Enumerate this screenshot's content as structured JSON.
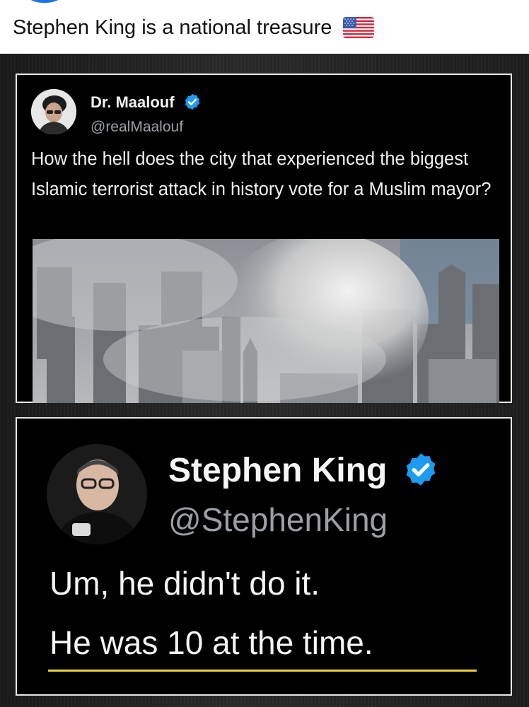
{
  "post": {
    "caption": "Stephen King is a national treasure",
    "flag_icon": "us-flag-icon"
  },
  "tweet_1": {
    "display_name": "Dr. Maalouf",
    "handle": "@realMaalouf",
    "verified_icon": "verified-badge-icon",
    "text": "How the hell does the city that experienced the biggest Islamic terrorist attack in history vote for a Muslim mayor?",
    "image": "collapse-smoke-photo"
  },
  "tweet_2": {
    "display_name": "Stephen King",
    "handle": "@StephenKing",
    "verified_icon": "verified-badge-icon",
    "text_line_1": "Um, he didn't do it.",
    "text_line_2": "He was 10 at the time."
  },
  "colors": {
    "verified": "#1d9bf0",
    "underline": "#e8d43a",
    "card_background": "#000000"
  }
}
